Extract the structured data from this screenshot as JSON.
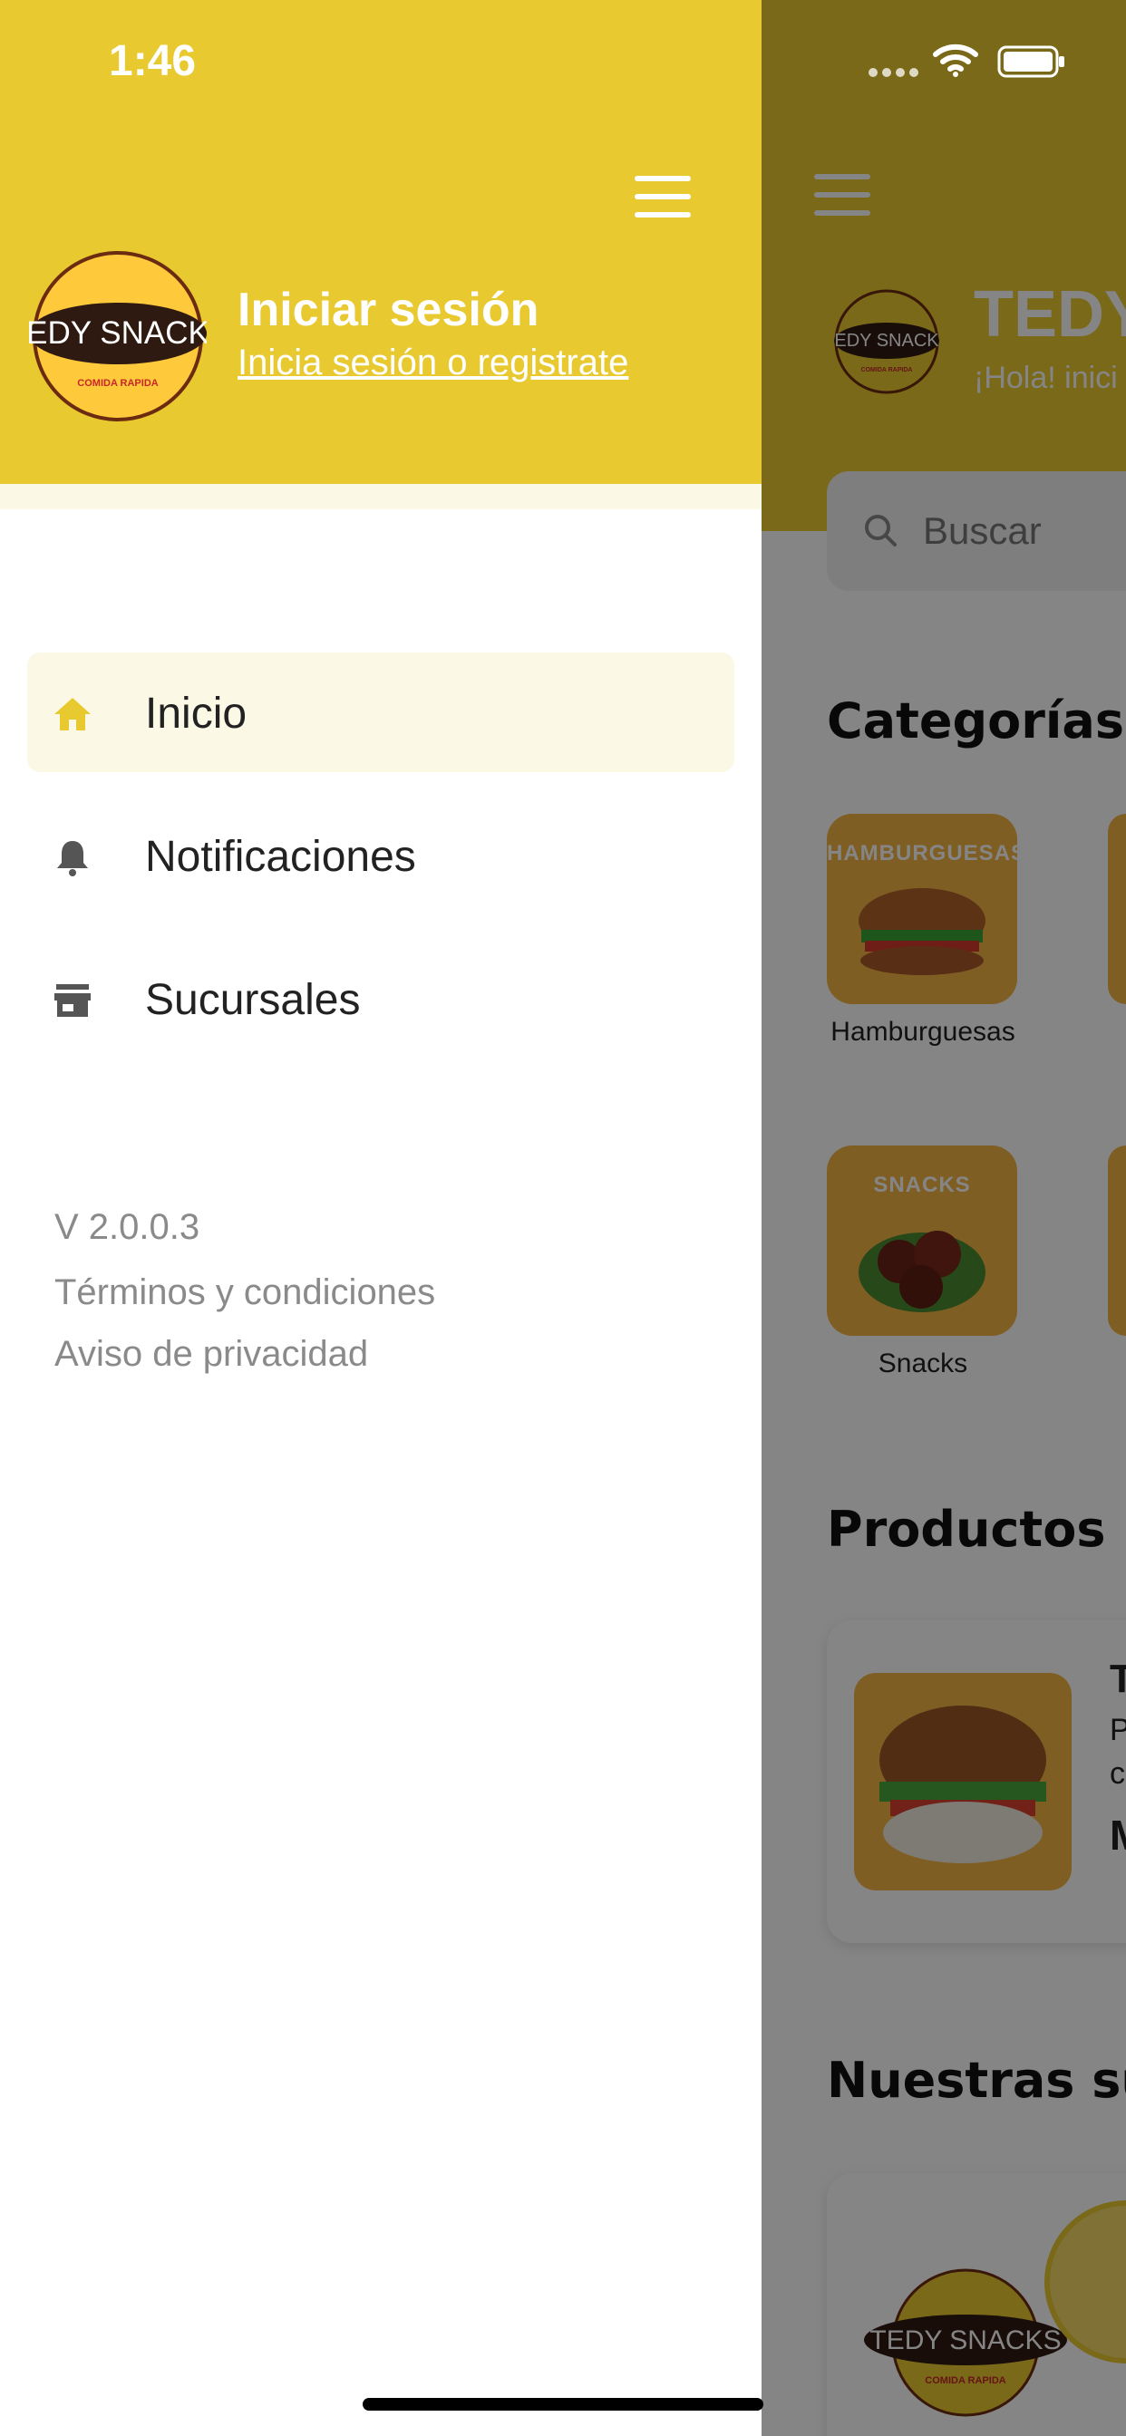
{
  "status_bar": {
    "time": "1:46"
  },
  "drawer": {
    "login_title": "Iniciar sesión",
    "login_link": "Inicia sesión o registrate",
    "logo_text": "EDY SNACK",
    "logo_subtext": "COMIDA RAPIDA",
    "nav": [
      {
        "label": "Inicio",
        "icon": "home-icon",
        "active": true
      },
      {
        "label": "Notificaciones",
        "icon": "bell-icon",
        "active": false
      },
      {
        "label": "Sucursales",
        "icon": "store-icon",
        "active": false
      }
    ],
    "version": "V 2.0.0.3",
    "terms": "Términos y condiciones",
    "privacy": "Aviso de privacidad"
  },
  "background": {
    "brand": "TEDY",
    "greeting": "¡Hola! inici",
    "logo_text": "EDY SNACK",
    "logo_subtext": "COMIDA RAPIDA",
    "search_placeholder": "Buscar",
    "categories_title": "Categorías",
    "categories": [
      {
        "title": "HAMBURGUESAS",
        "label": "Hamburguesas"
      },
      {
        "title": "SNACKS",
        "label": "Snacks"
      }
    ],
    "products_title": "Productos p",
    "product_letters": [
      "T",
      "P",
      "c",
      "M"
    ],
    "branches_title": "Nuestras su",
    "branch_logo_text": "TEDY SNACKS",
    "branch_logo_subtext": "COMIDA RAPIDA"
  },
  "colors": {
    "brand_yellow": "#E9C930",
    "active_bg": "#FCF8E6",
    "category_bg": "#F3B545"
  }
}
